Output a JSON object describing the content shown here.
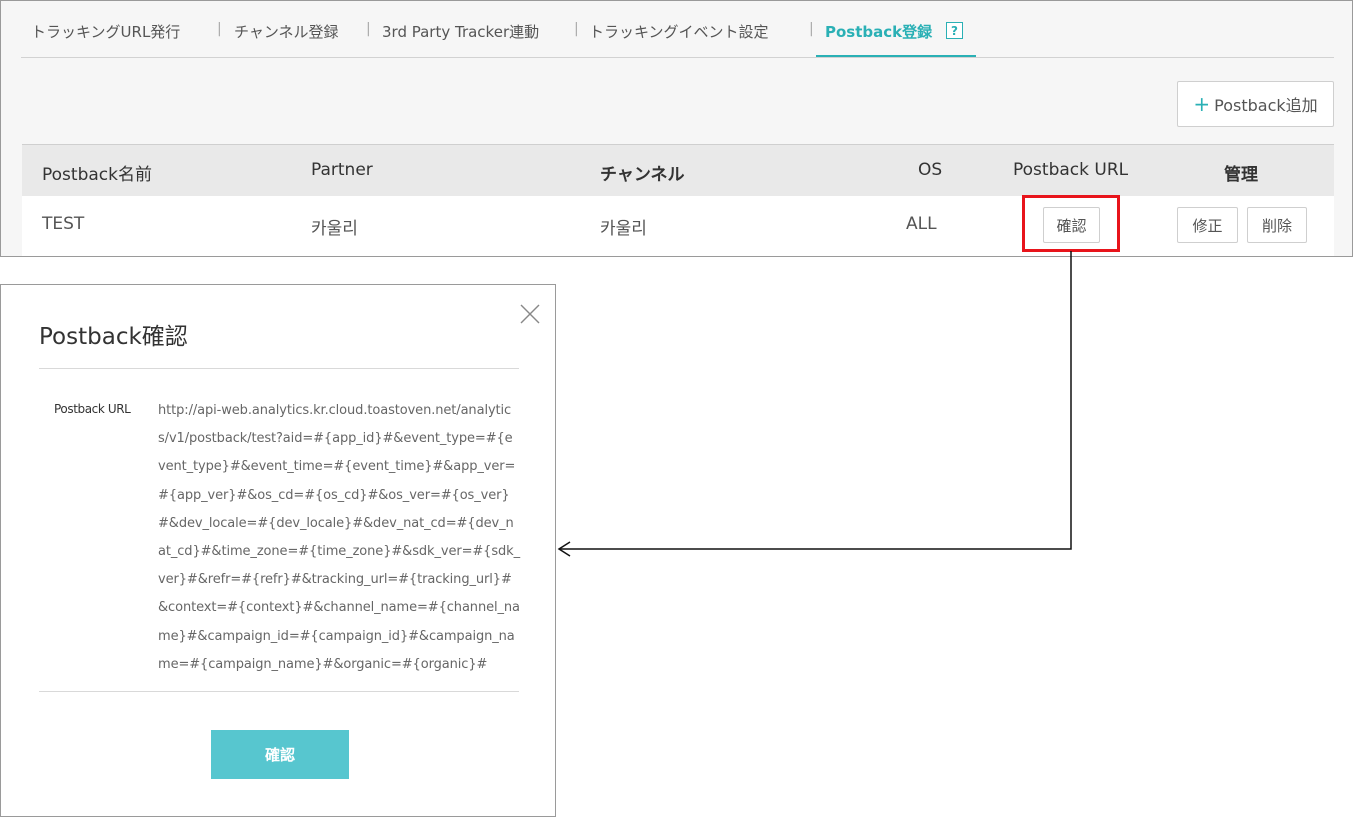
{
  "tabs": [
    {
      "label": "トラッキングURL発行"
    },
    {
      "label": "チャンネル登録"
    },
    {
      "label": "3rd Party Tracker連動"
    },
    {
      "label": "トラッキングイベント設定"
    },
    {
      "label": "Postback登録"
    }
  ],
  "tab_separator": "|",
  "help_icon_text": "?",
  "add_button_label": "Postback追加",
  "add_button_icon": "+",
  "table": {
    "headers": [
      "Postback名前",
      "Partner",
      "チャンネル",
      "OS",
      "Postback URL",
      "管理"
    ],
    "rows": [
      {
        "name": "TEST",
        "partner": "카울리",
        "channel": "카울리",
        "os": "ALL",
        "confirm": "確認",
        "edit": "修正",
        "delete": "削除"
      }
    ]
  },
  "modal": {
    "title": "Postback確認",
    "field_label": "Postback URL",
    "url": "http://api-web.analytics.kr.cloud.toastoven.net/analytics/v1/postback/test?aid=#{app_id}#&event_type=#{event_type}#&event_time=#{event_time}#&app_ver=#{app_ver}#&os_cd=#{os_cd}#&os_ver=#{os_ver}#&dev_locale=#{dev_locale}#&dev_nat_cd=#{dev_nat_cd}#&time_zone=#{time_zone}#&sdk_ver=#{sdk_ver}#&refr=#{refr}#&tracking_url=#{tracking_url}#&context=#{context}#&channel_name=#{channel_name}#&campaign_id=#{campaign_id}#&campaign_name=#{campaign_name}#&organic=#{organic}#",
    "confirm_label": "確認"
  },
  "colors": {
    "accent": "#2ab0b5",
    "highlight": "#e8141b",
    "confirm_button": "#57c6cf"
  }
}
